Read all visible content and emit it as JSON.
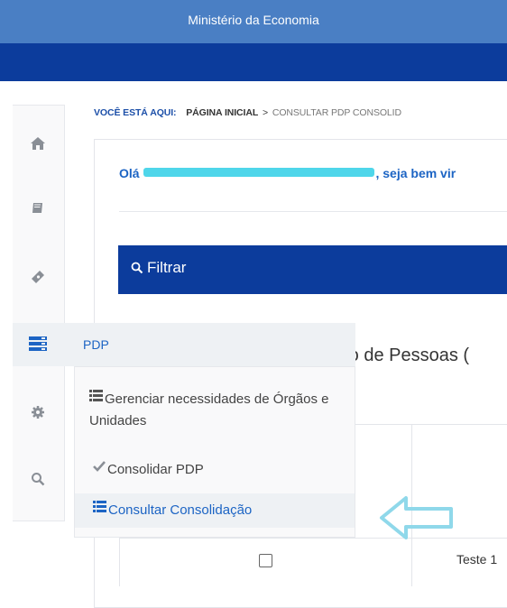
{
  "header": {
    "title": "Ministério da Economia"
  },
  "sidebar": {
    "icons": [
      "home-icon",
      "book-icon",
      "ticket-icon",
      "server-icon",
      "gear-icon",
      "search-icon"
    ]
  },
  "breadcrumb": {
    "label": "VOCÊ ESTÁ AQUI:",
    "home": "PÁGINA INICIAL",
    "separator": ">",
    "current": "CONSULTAR PDP CONSOLID"
  },
  "main": {
    "greeting_prefix": "Olá",
    "greeting_suffix": ", seja bem vir",
    "filter_label": "Filtrar",
    "heading": "nto de Pessoas (",
    "table": {
      "first_cell_text": "Teste 1"
    }
  },
  "menu": {
    "title": "PDP",
    "items": [
      {
        "label": "Gerenciar necessidades de Órgãos e Unidades",
        "icon": "list-icon"
      },
      {
        "label": "Consolidar PDP",
        "icon": "check-icon"
      },
      {
        "label": "Consultar Consolidação",
        "icon": "list-icon"
      }
    ]
  },
  "colors": {
    "top_bar": "#4a7fc4",
    "nav_bar": "#0c3c9c",
    "link_blue": "#1c64c4",
    "annotation_arrow": "#8fd8ea"
  }
}
